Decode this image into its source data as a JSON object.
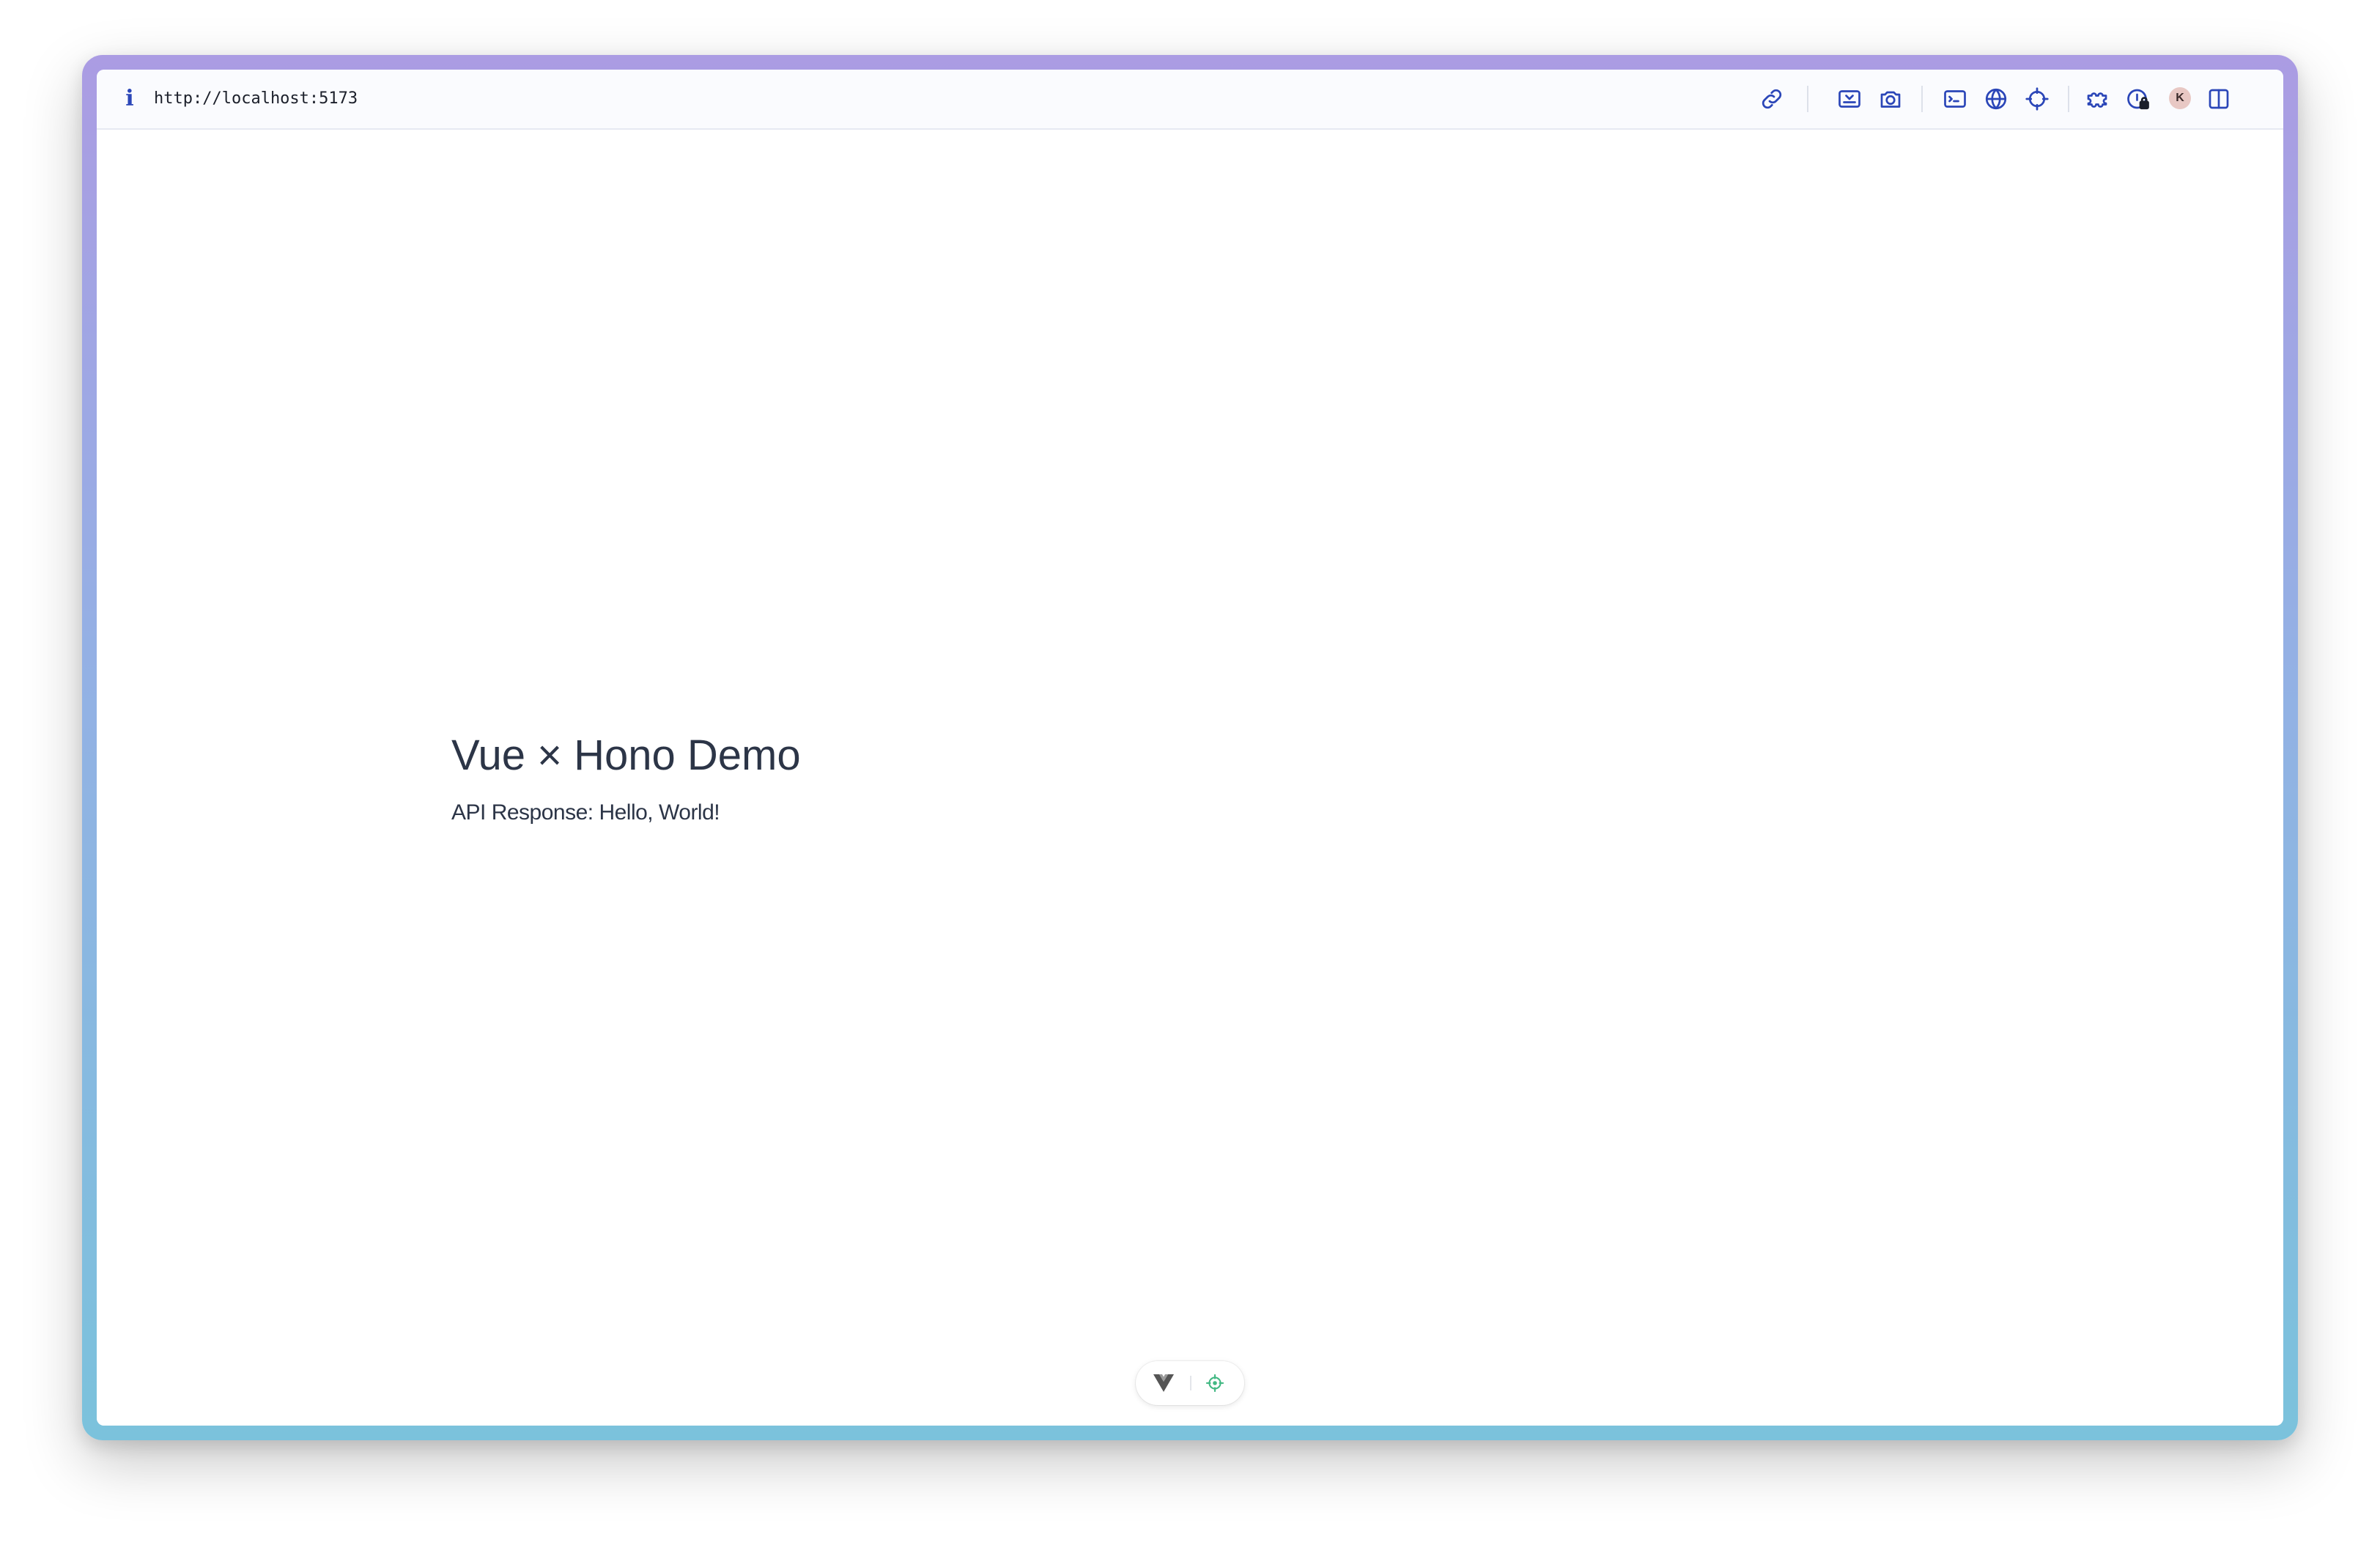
{
  "toolbar": {
    "url": "http://localhost:5173",
    "icons": [
      "info-icon",
      "link-icon",
      "screenshot-area-icon",
      "camera-icon",
      "terminal-icon",
      "globe-icon",
      "crosshair-icon",
      "extension-icon",
      "password-lock-icon",
      "avatar",
      "split-view-icon"
    ],
    "avatar_initial": "K",
    "accent_color": "#2b46b8"
  },
  "page": {
    "title": "Vue × Hono Demo",
    "api_response": "API Response: Hello, World!"
  },
  "devtools_pill": {
    "icons": [
      "vue-logo-icon",
      "inspector-target-icon"
    ],
    "vue_color": "#555555",
    "target_color": "#42b883"
  }
}
